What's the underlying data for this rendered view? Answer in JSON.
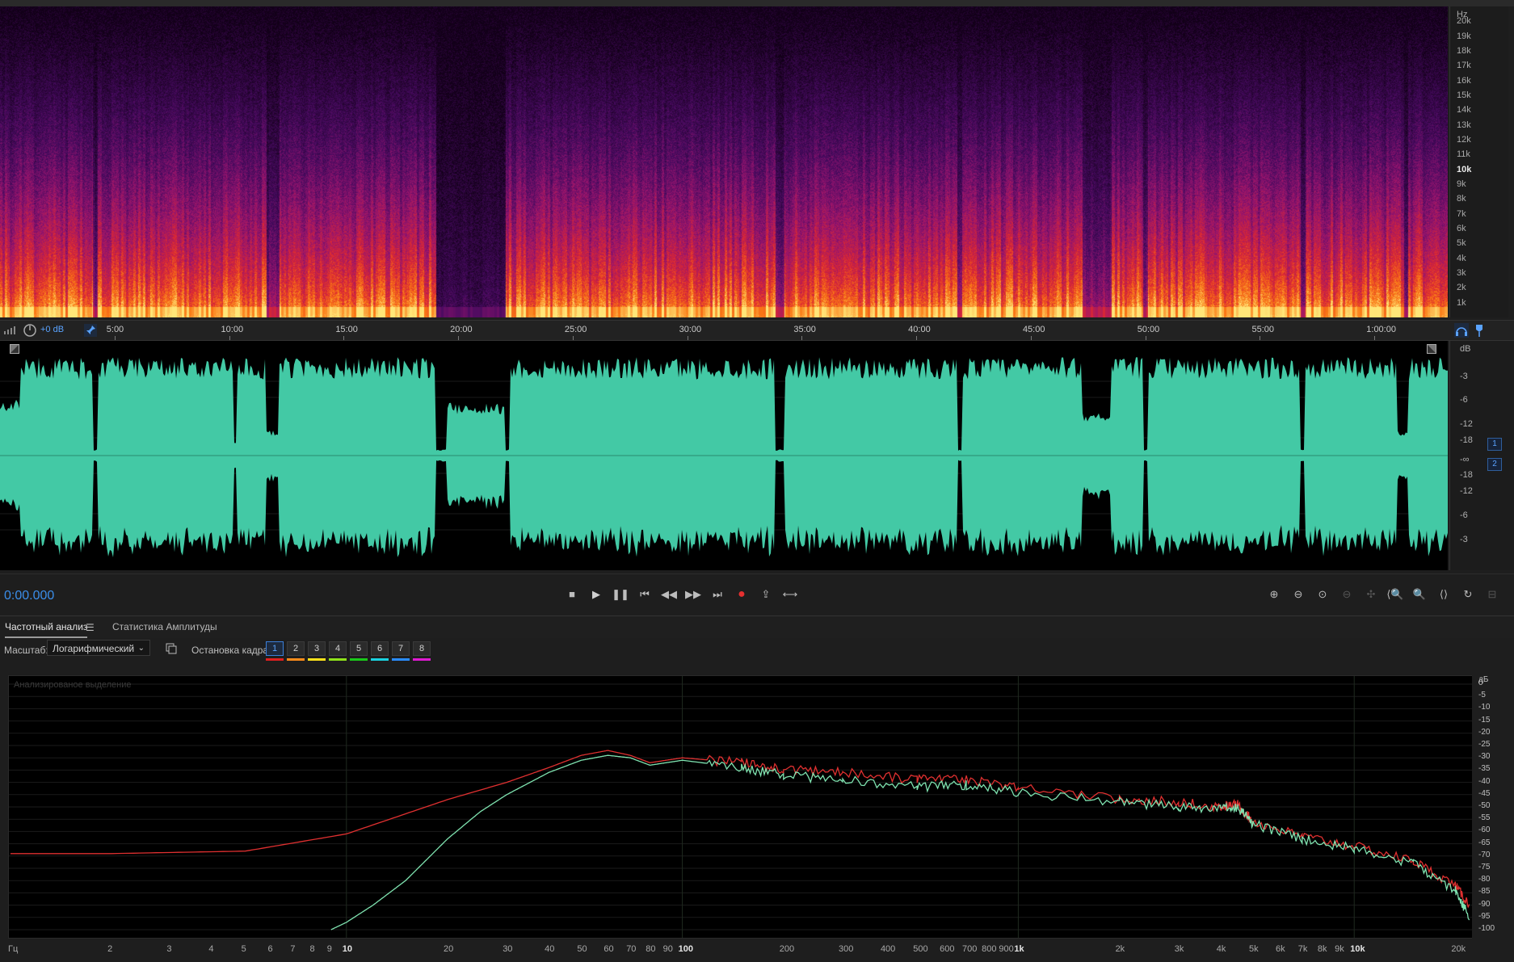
{
  "spectral_display": {
    "freq_unit": "Hz",
    "freq_labels": [
      "20k",
      "19k",
      "18k",
      "17k",
      "16k",
      "15k",
      "14k",
      "13k",
      "12k",
      "11k",
      "10k",
      "9k",
      "8k",
      "7k",
      "6k",
      "5k",
      "4k",
      "3k",
      "2k",
      "1k"
    ],
    "freq_label_values": [
      20000,
      19000,
      18000,
      17000,
      16000,
      15000,
      14000,
      13000,
      12000,
      11000,
      10000,
      9000,
      8000,
      7000,
      6000,
      5000,
      4000,
      3000,
      2000,
      1000
    ],
    "freq_max": 21000
  },
  "timeline": {
    "gain_label": "+0 dB",
    "labels": [
      "5:00",
      "10:00",
      "15:00",
      "20:00",
      "25:00",
      "30:00",
      "35:00",
      "40:00",
      "45:00",
      "50:00",
      "55:00",
      "1:00:00"
    ],
    "label_seconds": [
      300,
      600,
      900,
      1200,
      1500,
      1800,
      2100,
      2400,
      2700,
      3000,
      3300,
      3600
    ],
    "view_start_seconds": 0,
    "view_end_seconds": 3792
  },
  "waveform": {
    "db_unit": "dB",
    "db_labels": [
      "-3",
      "-6",
      "-12",
      "-18",
      "-∞",
      "-18",
      "-12",
      "-6",
      "-3"
    ],
    "channels": [
      "1",
      "2"
    ],
    "colors": {
      "wave": "#43c9a5",
      "background": "#000000"
    }
  },
  "transport": {
    "timecode": "0:00.000",
    "buttons": [
      "stop",
      "play",
      "pause",
      "go-to-start",
      "rewind",
      "fast-forward",
      "go-to-end",
      "record",
      "skip-selection",
      "loop"
    ]
  },
  "analysis_tabs": {
    "active": "Частотный анализ",
    "items": [
      "Частотный анализ",
      "Статистика Амплитуды"
    ]
  },
  "analysis_controls": {
    "scale_label": "Масштаб:",
    "scale_value": "Логарифмический",
    "hold_label": "Остановка кадра:",
    "frames": [
      {
        "label": "1",
        "color": "#e02020"
      },
      {
        "label": "2",
        "color": "#ff8c1a"
      },
      {
        "label": "3",
        "color": "#ffe21a"
      },
      {
        "label": "4",
        "color": "#8fe21a"
      },
      {
        "label": "5",
        "color": "#1ac81a"
      },
      {
        "label": "6",
        "color": "#1ad2e0"
      },
      {
        "label": "7",
        "color": "#2a8cff"
      },
      {
        "label": "8",
        "color": "#e01ad2"
      }
    ]
  },
  "frequency_analysis": {
    "caption": "Анализированое выделение",
    "db_unit": "дБ",
    "db_labels": [
      "0",
      "-5",
      "-10",
      "-15",
      "-20",
      "-25",
      "-30",
      "-35",
      "-40",
      "-45",
      "-50",
      "-55",
      "-60",
      "-65",
      "-70",
      "-75",
      "-80",
      "-85",
      "-90",
      "-95",
      "-100"
    ],
    "x_unit": "Гц",
    "x_labels": [
      "2",
      "3",
      "4",
      "5",
      "6",
      "7",
      "8",
      "9",
      "10",
      "20",
      "30",
      "40",
      "50",
      "60",
      "70",
      "80",
      "90",
      "100",
      "200",
      "300",
      "400",
      "500",
      "600",
      "700",
      "800",
      "900",
      "1k",
      "2k",
      "3k",
      "4k",
      "5k",
      "6k",
      "7k",
      "8k",
      "9k",
      "10k",
      "20k"
    ],
    "x_label_values": [
      2,
      3,
      4,
      5,
      6,
      7,
      8,
      9,
      10,
      20,
      30,
      40,
      50,
      60,
      70,
      80,
      90,
      100,
      200,
      300,
      400,
      500,
      600,
      700,
      800,
      900,
      1000,
      2000,
      3000,
      4000,
      5000,
      6000,
      7000,
      8000,
      9000,
      10000,
      20000
    ],
    "x_bold": [
      "10",
      "100",
      "1k",
      "10k"
    ]
  },
  "chart_data": {
    "type": "line",
    "xscale": "log",
    "xlim": [
      1,
      22050
    ],
    "ylim": [
      -100,
      0
    ],
    "ylabel": "дБ",
    "xlabel": "Гц",
    "series": [
      {
        "color": "#e03030",
        "x": [
          1,
          2,
          5,
          10,
          20,
          30,
          40,
          50,
          60,
          70,
          80,
          100,
          150,
          200,
          300,
          500,
          700,
          1000,
          2000,
          3000,
          4000,
          4500,
          5000,
          7000,
          10000,
          15000,
          20000,
          22000
        ],
        "y": [
          -69,
          -69,
          -68,
          -61,
          -47,
          -40,
          -34,
          -29,
          -27,
          -29,
          -32,
          -30,
          -32,
          -35,
          -36,
          -39,
          -39,
          -42,
          -47,
          -48,
          -50,
          -49,
          -56,
          -62,
          -66,
          -72,
          -82,
          -90
        ]
      },
      {
        "color": "#7fe3b0",
        "x": [
          9,
          10,
          12,
          15,
          20,
          25,
          30,
          40,
          50,
          60,
          70,
          80,
          100,
          150,
          200,
          300,
          500,
          700,
          1000,
          2000,
          3000,
          4000,
          4500,
          5000,
          7000,
          10000,
          15000,
          20000,
          22000
        ],
        "y": [
          -100,
          -97,
          -90,
          -80,
          -63,
          -52,
          -45,
          -36,
          -31,
          -29,
          -30,
          -33,
          -31,
          -34,
          -37,
          -39,
          -42,
          -41,
          -44,
          -48,
          -50,
          -51,
          -50,
          -57,
          -63,
          -67,
          -73,
          -84,
          -95
        ]
      }
    ]
  }
}
